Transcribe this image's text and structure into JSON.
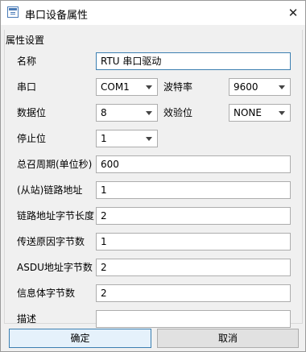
{
  "window": {
    "title": "串口设备属性",
    "close_symbol": "✕"
  },
  "group": {
    "title": "属性设置"
  },
  "fields": {
    "name": {
      "label": "名称",
      "value": "RTU 串口驱动"
    },
    "port": {
      "label": "串口",
      "value": "COM1"
    },
    "baud": {
      "label": "波特率",
      "value": "9600"
    },
    "databits": {
      "label": "数据位",
      "value": "8"
    },
    "parity": {
      "label": "效验位",
      "value": "NONE"
    },
    "stopbits": {
      "label": "停止位",
      "value": "1"
    },
    "period": {
      "label": "总召周期(单位秒)",
      "value": "600"
    },
    "slave": {
      "label": "(从站)链路地址",
      "value": "1"
    },
    "link_len": {
      "label": "链路地址字节长度",
      "value": "2"
    },
    "cot_bytes": {
      "label": "传送原因字节数",
      "value": "1"
    },
    "asdu_bytes": {
      "label": "ASDU地址字节数",
      "value": "2"
    },
    "ioa_bytes": {
      "label": "信息体字节数",
      "value": "2"
    },
    "desc": {
      "label": "描述",
      "value": ""
    }
  },
  "buttons": {
    "ok": "确定",
    "cancel": "取消"
  }
}
